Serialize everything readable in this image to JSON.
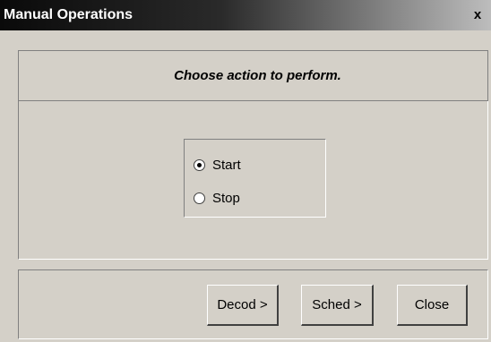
{
  "window": {
    "title": "Manual Operations",
    "close_glyph": "x"
  },
  "header": {
    "prompt": "Choose action to perform."
  },
  "actions": {
    "options": [
      {
        "label": "Start",
        "selected": true
      },
      {
        "label": "Stop",
        "selected": false
      }
    ]
  },
  "buttons": {
    "decod_label": "Decod >",
    "sched_label": "Sched >",
    "close_label": "Close"
  }
}
